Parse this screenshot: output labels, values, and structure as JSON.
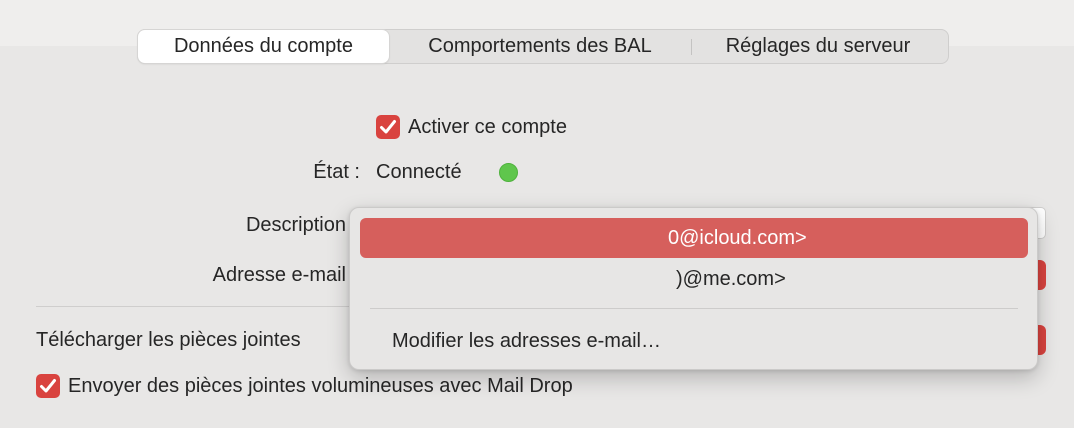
{
  "tabs": [
    {
      "label": "Données du compte",
      "selected": true
    },
    {
      "label": "Comportements des BAL",
      "selected": false
    },
    {
      "label": "Réglages du serveur",
      "selected": false
    }
  ],
  "account": {
    "enable_checkbox_label": "Activer ce compte",
    "enable_checked": true,
    "state_label": "État :",
    "state_value": "Connecté",
    "state_color": "#5fc64c",
    "description_label": "Description",
    "email_label": "Adresse e-mail",
    "download_attachments_label": "Télécharger les pièces jointes",
    "maildrop_label": "Envoyer des pièces jointes volumineuses avec Mail Drop",
    "maildrop_checked": true
  },
  "email_menu": {
    "items": [
      {
        "label": "0@icloud.com>",
        "highlighted": true
      },
      {
        "label": ")@me.com>",
        "highlighted": false
      }
    ],
    "edit_label": "Modifier les adresses e-mail…"
  },
  "colors": {
    "accent": "#d9433f",
    "menu_highlight": "#d65f5c",
    "background": "#e8e7e6"
  }
}
